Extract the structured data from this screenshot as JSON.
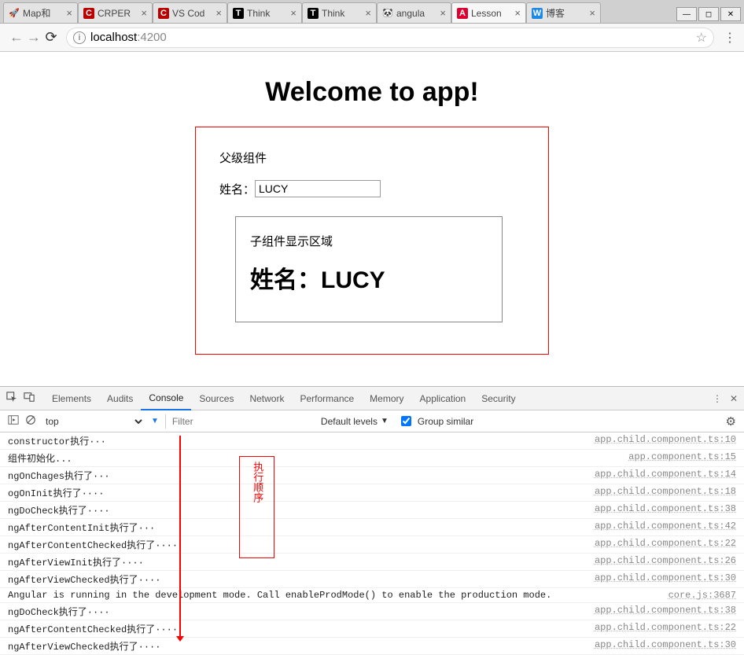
{
  "browser_tabs": [
    {
      "favicon": "🚀",
      "label": "Map和"
    },
    {
      "favicon": "C",
      "favcolor": "#b00",
      "label": "CRPER"
    },
    {
      "favicon": "C",
      "favcolor": "#b00",
      "label": "VS Cod"
    },
    {
      "favicon": "T",
      "favcolor": "#000",
      "label": "Think"
    },
    {
      "favicon": "T",
      "favcolor": "#000",
      "label": "Think"
    },
    {
      "favicon": "🐼",
      "label": "angula"
    },
    {
      "favicon": "A",
      "favcolor": "#dd0031",
      "label": "Lesson",
      "active": true
    },
    {
      "favicon": "W",
      "favcolor": "#1e88e5",
      "label": "博客"
    }
  ],
  "url": {
    "host": "localhost",
    "port": ":4200"
  },
  "page": {
    "heading": "Welcome to app!",
    "parent_label": "父级组件",
    "name_label": "姓名：",
    "name_value": "LUCY",
    "child_label": "子组件显示区域",
    "child_name": "姓名：LUCY"
  },
  "devtools": {
    "tabs": [
      "Elements",
      "Audits",
      "Console",
      "Sources",
      "Network",
      "Performance",
      "Memory",
      "Application",
      "Security"
    ],
    "active_tab": "Console",
    "context": "top",
    "filter_placeholder": "Filter",
    "levels_label": "Default levels",
    "group_label": "Group similar",
    "annotation": "执行顺序",
    "logs": [
      {
        "msg": "constructor执行···",
        "src": "app.child.component.ts:10"
      },
      {
        "msg": "组件初始化...",
        "src": "app.component.ts:15"
      },
      {
        "msg": "ngOnChages执行了···",
        "src": "app.child.component.ts:14"
      },
      {
        "msg": "ogOnInit执行了····",
        "src": "app.child.component.ts:18"
      },
      {
        "msg": "ngDoCheck执行了····",
        "src": "app.child.component.ts:38"
      },
      {
        "msg": "ngAfterContentInit执行了···",
        "src": "app.child.component.ts:42"
      },
      {
        "msg": "ngAfterContentChecked执行了····",
        "src": "app.child.component.ts:22"
      },
      {
        "msg": "ngAfterViewInit执行了····",
        "src": "app.child.component.ts:26"
      },
      {
        "msg": "ngAfterViewChecked执行了····",
        "src": "app.child.component.ts:30"
      },
      {
        "msg": "Angular is running in the development mode. Call enableProdMode() to enable the production mode.",
        "src": "core.js:3687"
      },
      {
        "msg": "ngDoCheck执行了····",
        "src": "app.child.component.ts:38"
      },
      {
        "msg": "ngAfterContentChecked执行了····",
        "src": "app.child.component.ts:22"
      },
      {
        "msg": "ngAfterViewChecked执行了····",
        "src": "app.child.component.ts:30"
      }
    ]
  }
}
